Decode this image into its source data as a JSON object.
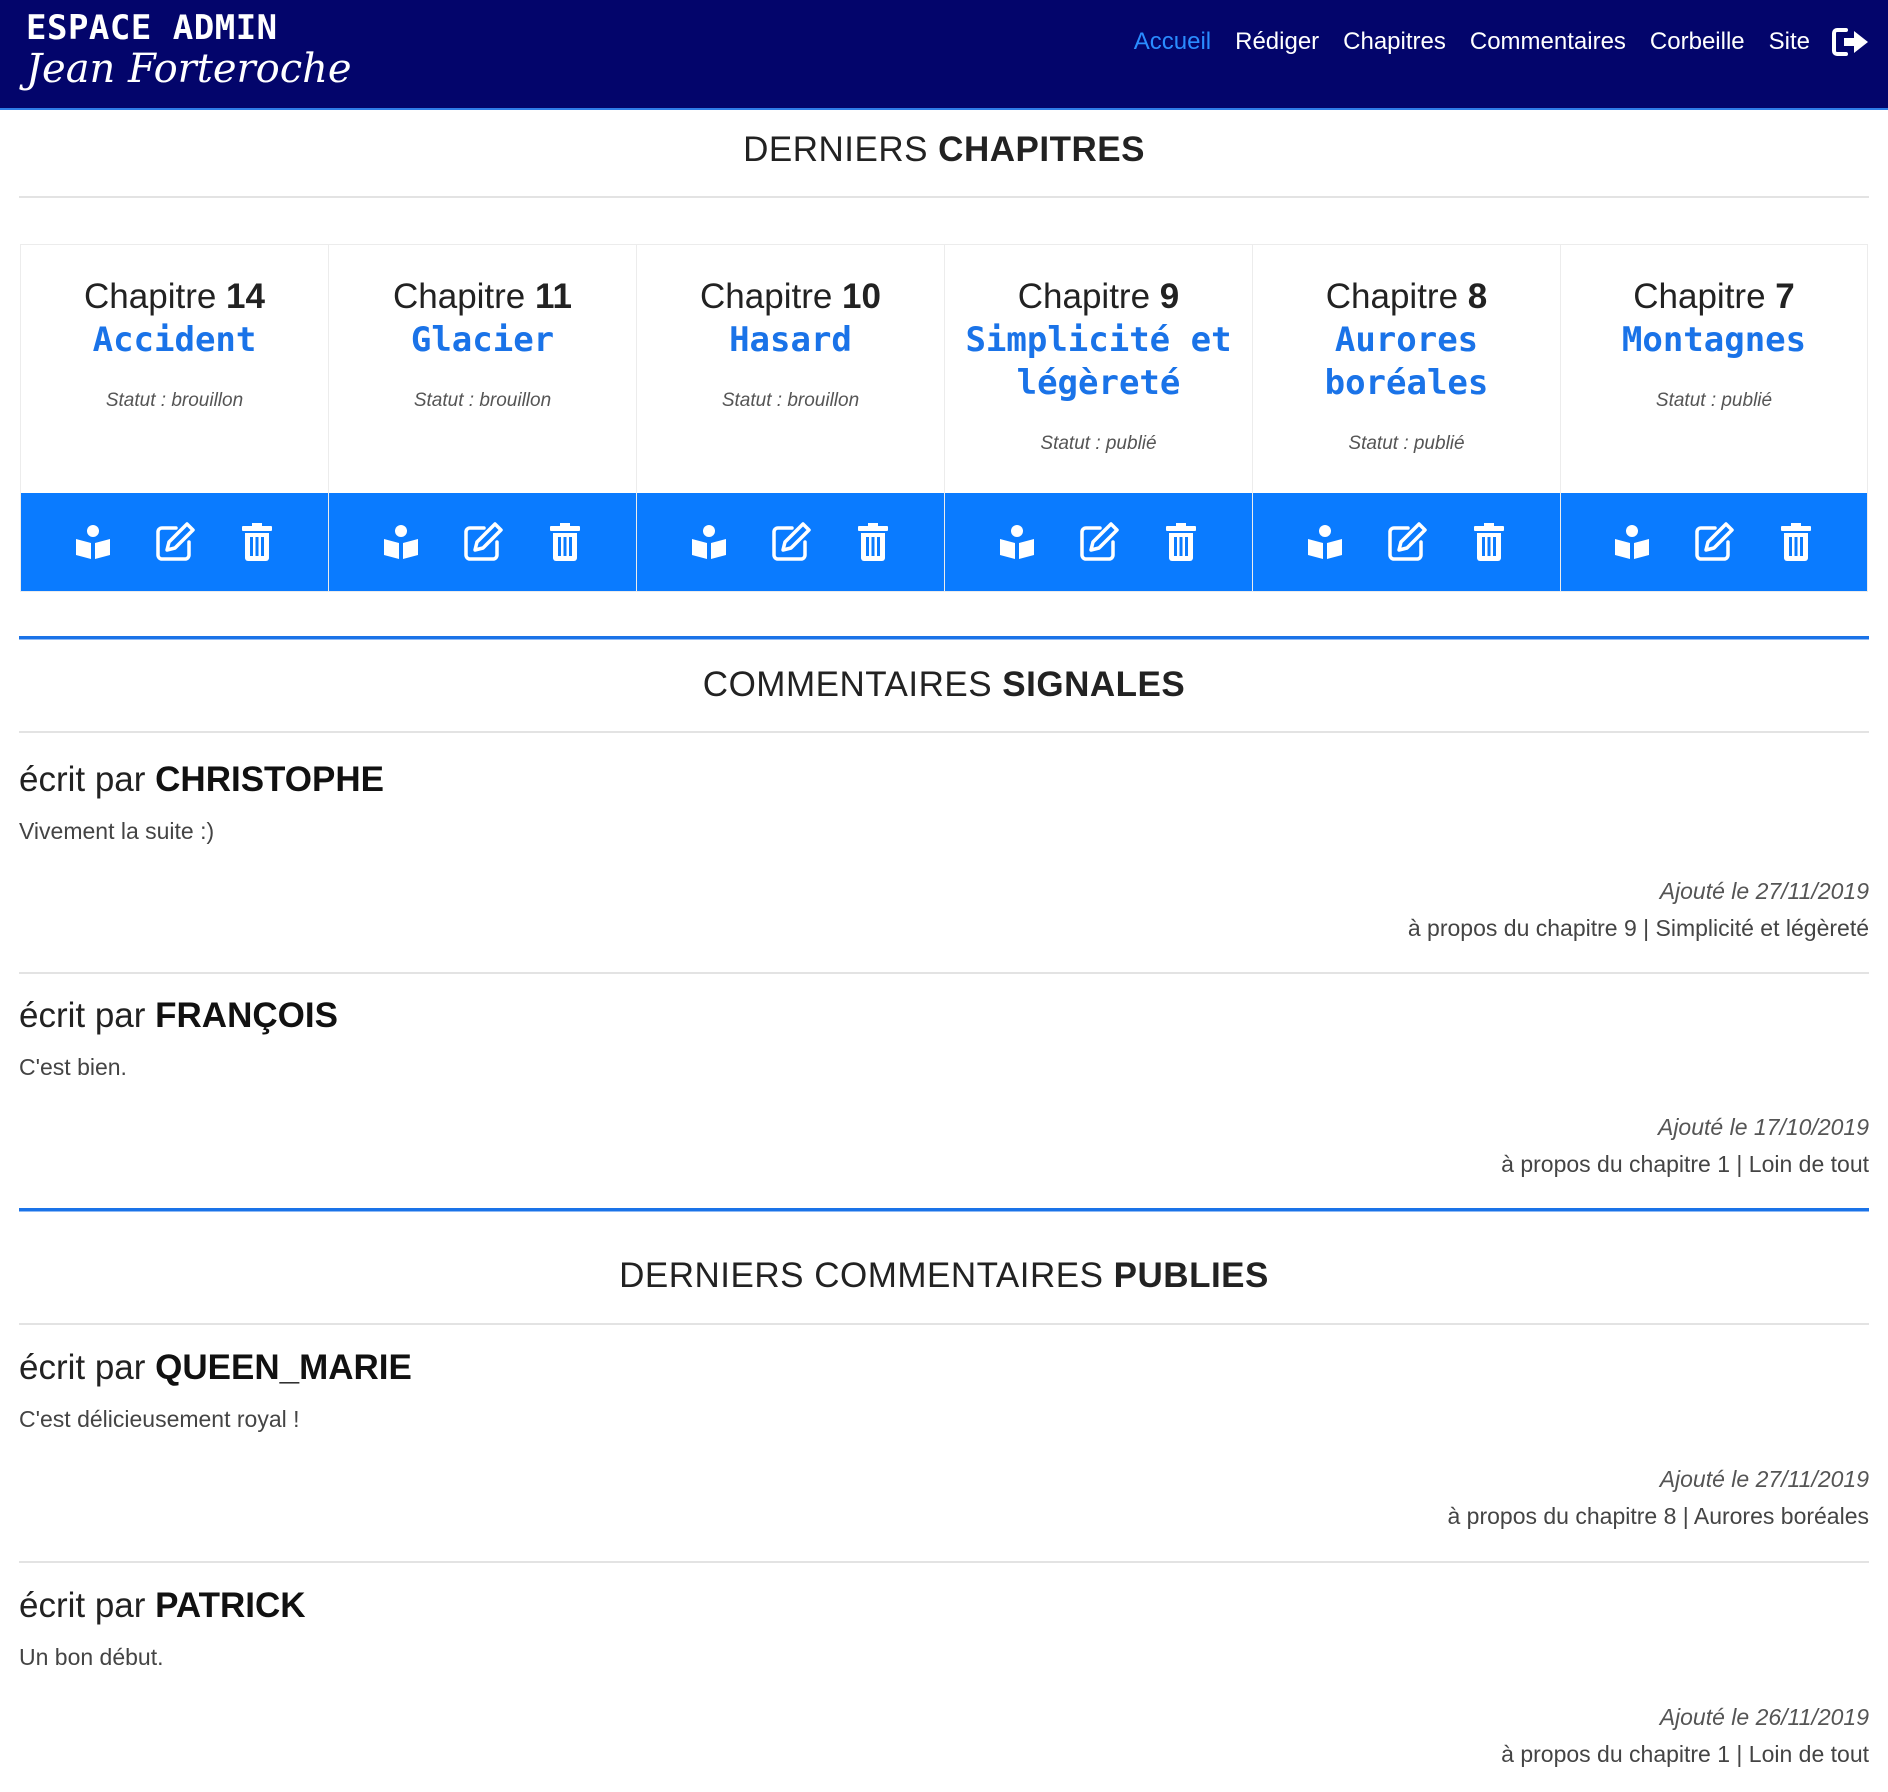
{
  "header": {
    "brand_top": "ESPACE ADMIN",
    "brand_sub": "Jean Forteroche",
    "nav": [
      {
        "label": "Accueil",
        "active": true
      },
      {
        "label": "Rédiger",
        "active": false
      },
      {
        "label": "Chapitres",
        "active": false
      },
      {
        "label": "Commentaires",
        "active": false
      },
      {
        "label": "Corbeille",
        "active": false
      },
      {
        "label": "Site",
        "active": false
      }
    ],
    "logout_icon": "sign-out-icon"
  },
  "sections": {
    "chapters": {
      "title_light": "DERNIERS ",
      "title_bold": "CHAPITRES"
    },
    "reported": {
      "title_light": "COMMENTAIRES ",
      "title_bold": "SIGNALES"
    },
    "published": {
      "title_light": "DERNIERS COMMENTAIRES ",
      "title_bold": "PUBLIES"
    }
  },
  "chapters": [
    {
      "label": "Chapitre ",
      "number": "14",
      "title": "Accident",
      "status": "Statut : brouillon"
    },
    {
      "label": "Chapitre ",
      "number": "11",
      "title": "Glacier",
      "status": "Statut : brouillon"
    },
    {
      "label": "Chapitre ",
      "number": "10",
      "title": "Hasard",
      "status": "Statut : brouillon"
    },
    {
      "label": "Chapitre ",
      "number": "9",
      "title": "Simplicité et légèreté",
      "status": "Statut : publié"
    },
    {
      "label": "Chapitre ",
      "number": "8",
      "title": "Aurores boréales",
      "status": "Statut : publié"
    },
    {
      "label": "Chapitre ",
      "number": "7",
      "title": "Montagnes",
      "status": "Statut : publié"
    }
  ],
  "chapter_actions": {
    "read_icon": "book-reader-icon",
    "edit_icon": "edit-icon",
    "delete_icon": "trash-icon"
  },
  "reported_comments": [
    {
      "prefix": "écrit par ",
      "author": "CHRISTOPHE",
      "text": "Vivement la suite :)",
      "date": "Ajouté le 27/11/2019",
      "about": "à propos du chapitre 9 | Simplicité et légèreté"
    },
    {
      "prefix": "écrit par ",
      "author": "FRANÇOIS",
      "text": "C'est bien.",
      "date": "Ajouté le 17/10/2019",
      "about": "à propos du chapitre 1 | Loin de tout"
    }
  ],
  "published_comments": [
    {
      "prefix": "écrit par ",
      "author": "QUEEN_MARIE",
      "text": "C'est délicieusement royal !",
      "date": "Ajouté le 27/11/2019",
      "about": "à propos du chapitre 8 | Aurores boréales"
    },
    {
      "prefix": "écrit par ",
      "author": "PATRICK",
      "text": "Un bon début.",
      "date": "Ajouté le 26/11/2019",
      "about": "à propos du chapitre 1 | Loin de tout"
    }
  ],
  "colors": {
    "header_bg": "#03056b",
    "accent": "#0a7bff",
    "title_blue": "#1a73e8",
    "active_nav": "#2a8cff"
  }
}
